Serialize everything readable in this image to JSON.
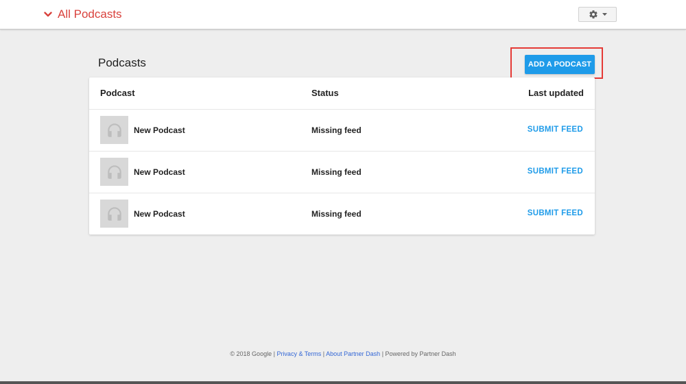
{
  "header": {
    "nav_title": "All Podcasts",
    "nav_icon": "chevron-down-icon",
    "settings_icon": "gear-icon",
    "settings_caret_icon": "caret-down-icon"
  },
  "main": {
    "title": "Podcasts",
    "add_button_label": "ADD A PODCAST",
    "table": {
      "columns": [
        "Podcast",
        "Status",
        "Last updated"
      ],
      "rows": [
        {
          "name": "New Podcast",
          "status": "Missing feed",
          "action": "SUBMIT FEED",
          "icon": "headphones-icon"
        },
        {
          "name": "New Podcast",
          "status": "Missing feed",
          "action": "SUBMIT FEED",
          "icon": "headphones-icon"
        },
        {
          "name": "New Podcast",
          "status": "Missing feed",
          "action": "SUBMIT FEED",
          "icon": "headphones-icon"
        }
      ]
    }
  },
  "footer": {
    "copyright": "© 2018 Google",
    "sep1": " | ",
    "privacy": "Privacy & Terms",
    "sep2": " | ",
    "about": "About Partner Dash",
    "sep3": " | ",
    "powered": "Powered by Partner Dash"
  },
  "colors": {
    "brand_red": "#d9413c",
    "accent_blue": "#1e9be9",
    "highlight_red": "#e53935",
    "background": "#eeeeee"
  }
}
